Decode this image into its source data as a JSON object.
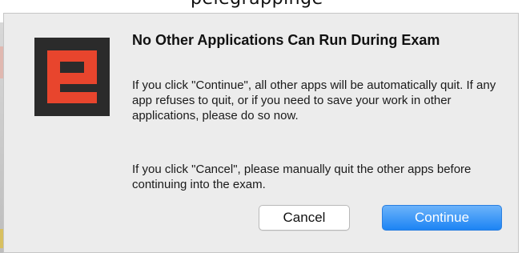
{
  "background_window": {
    "title_fragment": "pelegrappinge"
  },
  "dialog": {
    "title": "No Other Applications Can Run During Exam",
    "message_1": "If you click \"Continue\", all other apps will be automatically quit. If any app refuses to quit, or if you need to save your work in other applications, please do so now.",
    "message_2": "If you click \"Cancel\", please manually quit the other apps before continuing into the exam.",
    "cancel_label": "Cancel",
    "continue_label": "Continue",
    "icon": "exam-app-icon"
  },
  "colors": {
    "dialog_bg": "#ececec",
    "icon_bg": "#2b2b2b",
    "icon_accent": "#e8452d",
    "primary_button": "#1c84f4"
  }
}
